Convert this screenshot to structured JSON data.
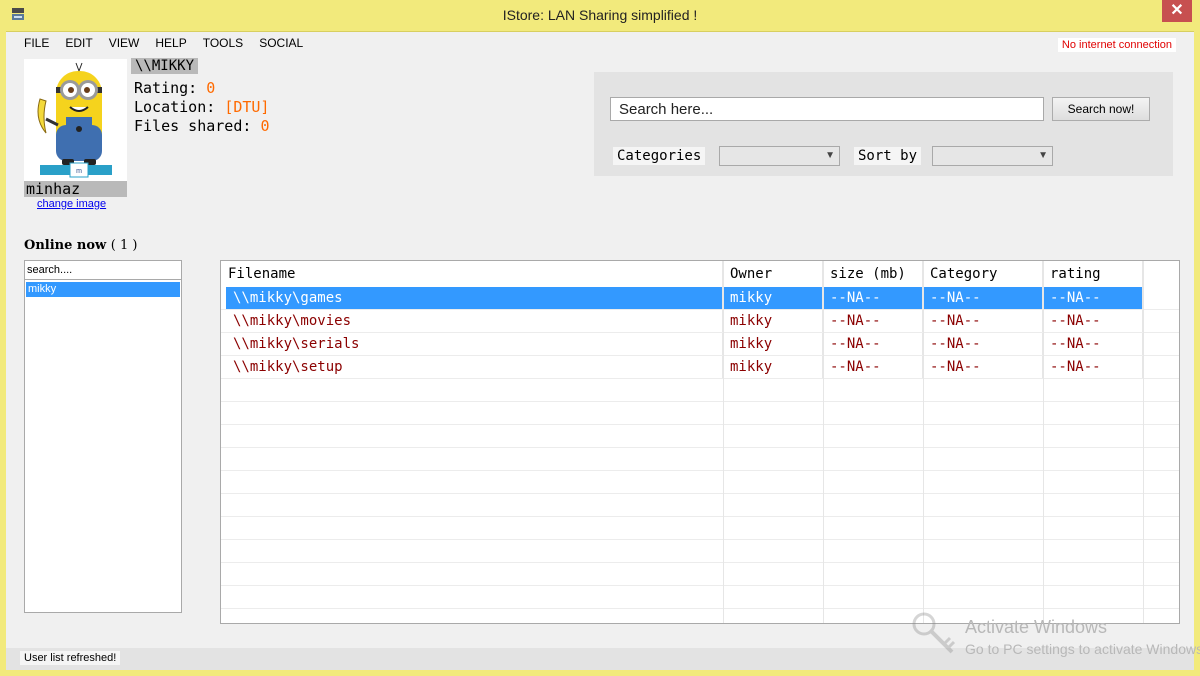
{
  "window": {
    "title": "IStore: LAN Sharing simplified !",
    "close_glyph": "✕"
  },
  "menu": [
    "FILE",
    "EDIT",
    "VIEW",
    "HELP",
    "TOOLS",
    "SOCIAL"
  ],
  "connection_status": "No internet connection",
  "profile": {
    "host": "\\\\MIKKY",
    "rating_label": "Rating:",
    "rating_value": "0",
    "location_label": "Location:",
    "location_value": "[DTU]",
    "files_label": "Files shared:",
    "files_value": "0",
    "username": "minhaz",
    "change_image": "change image",
    "badge_letter": "m"
  },
  "search": {
    "placeholder": "Search here...",
    "button": "Search now!",
    "categories_label": "Categories",
    "sortby_label": "Sort by"
  },
  "online": {
    "title": "Online now",
    "count": "( 1 )",
    "search_value": "search....",
    "users": [
      "mikky"
    ]
  },
  "table": {
    "headers": [
      "Filename",
      "Owner",
      "size (mb)",
      "Category",
      "rating"
    ],
    "rows": [
      [
        "\\\\mikky\\games",
        "mikky",
        "--NA--",
        "--NA--",
        "--NA--"
      ],
      [
        "\\\\mikky\\movies",
        "mikky",
        "--NA--",
        "--NA--",
        "--NA--"
      ],
      [
        "\\\\mikky\\serials",
        "mikky",
        "--NA--",
        "--NA--",
        "--NA--"
      ],
      [
        "\\\\mikky\\setup",
        "mikky",
        "--NA--",
        "--NA--",
        "--NA--"
      ]
    ],
    "selected_row": 0
  },
  "status": "User list refreshed!",
  "watermark": {
    "title": "Activate Windows",
    "subtitle": "Go to PC settings to activate Windows."
  }
}
